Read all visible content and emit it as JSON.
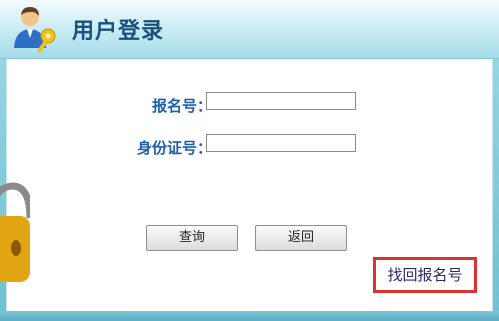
{
  "header": {
    "title": "用户登录",
    "logo_icon": "user-key-icon"
  },
  "form": {
    "fields": [
      {
        "label": "报名号：",
        "value": "",
        "placeholder": ""
      },
      {
        "label": "身份证号：",
        "value": "",
        "placeholder": ""
      }
    ],
    "buttons": {
      "query": "查询",
      "back": "返回"
    },
    "recover_link": "找回报名号"
  },
  "decor": {
    "lock_icon": "padlock-icon"
  },
  "colors": {
    "accent": "#1d5fa8",
    "highlight": "#e03030",
    "frame": "#7ec8d8"
  }
}
